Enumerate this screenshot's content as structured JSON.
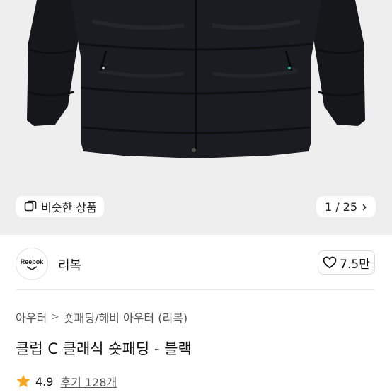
{
  "hero": {
    "similar_label": "비슷한 상품",
    "counter": "1 / 25",
    "counter_arrow": "›"
  },
  "brand": {
    "logo_text": "Reebok",
    "name": "리복"
  },
  "like": {
    "count": "7.5만"
  },
  "breadcrumb": {
    "root": "아우터",
    "separator": ">",
    "category": "숏패딩/헤비 아우터 (리복)"
  },
  "product": {
    "title": "클럽 C 클래식 숏패딩 - 블랙"
  },
  "rating": {
    "score": "4.9",
    "reviews": "후기 128개",
    "star_color": "#f5a623"
  }
}
